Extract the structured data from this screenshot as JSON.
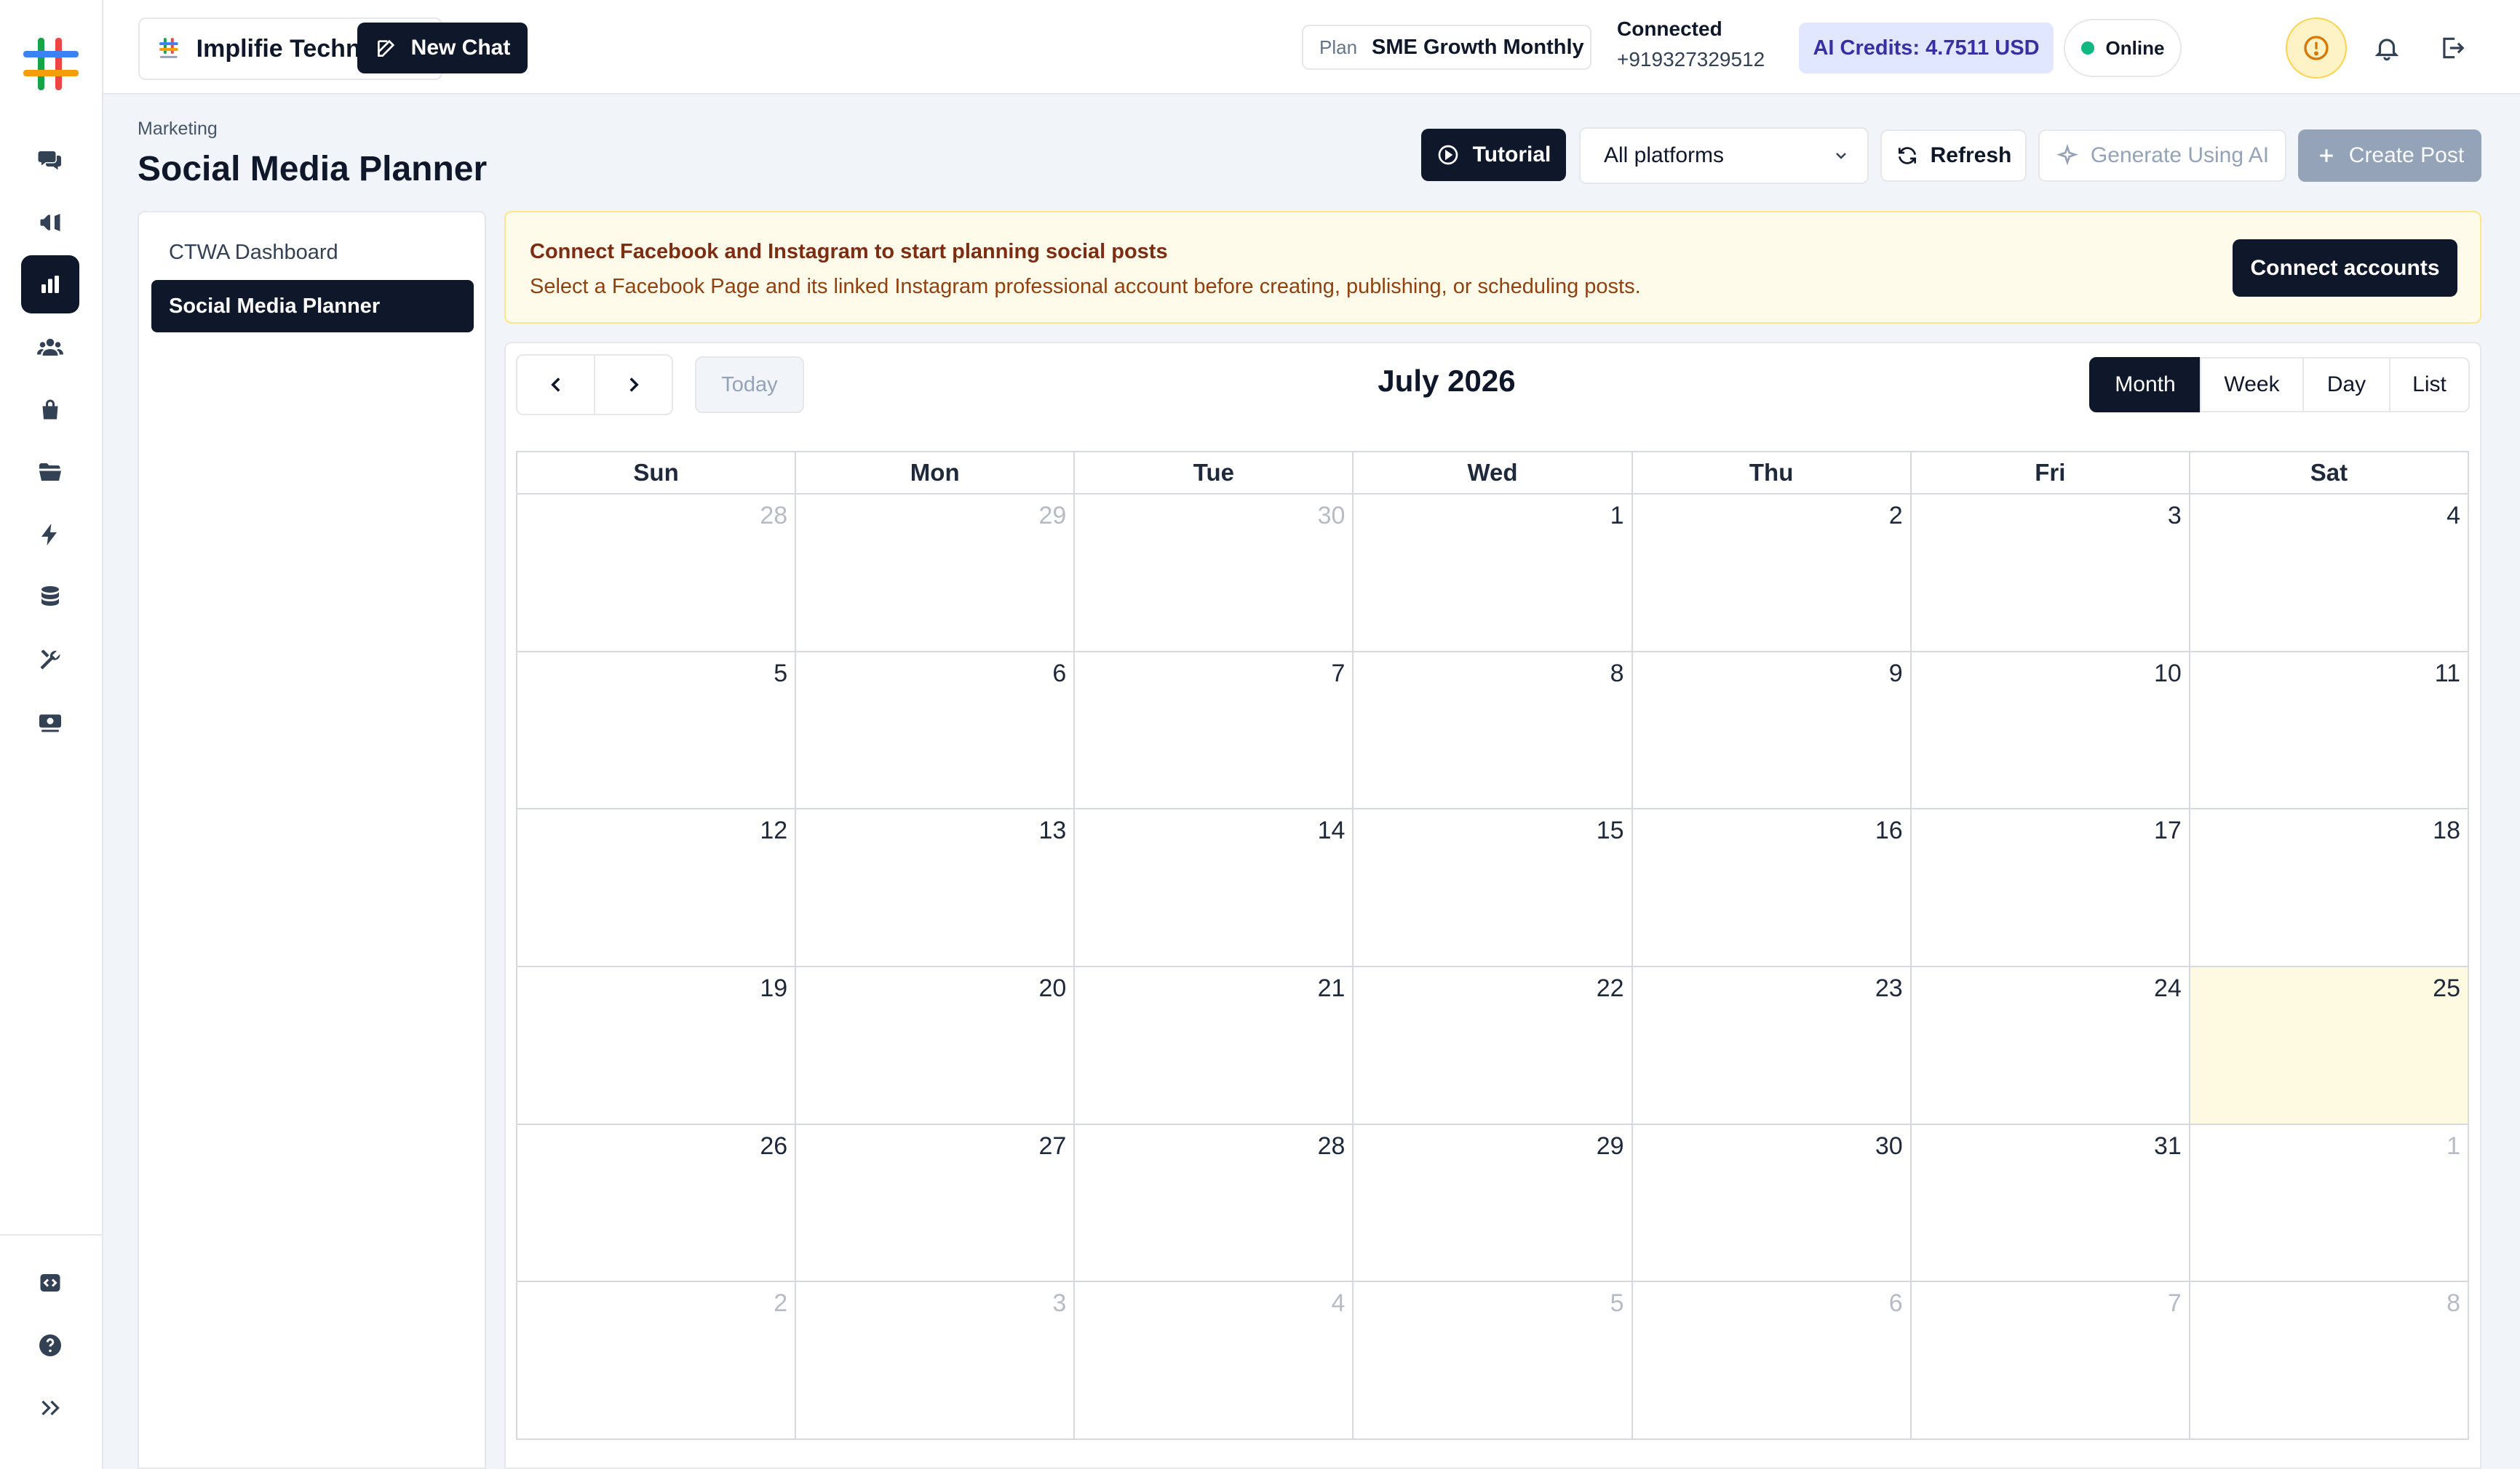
{
  "workspace": {
    "name": "Implifie Technol..."
  },
  "topbar": {
    "new_chat_label": "New Chat",
    "plan_label": "Plan",
    "plan_name": "SME Growth Monthly",
    "connected_title": "Connected",
    "connected_phone": "+919327329512",
    "credits": "AI Credits: 4.7511 USD",
    "status": "Online"
  },
  "page": {
    "breadcrumb": "Marketing",
    "title": "Social Media Planner"
  },
  "toolbar": {
    "tutorial": "Tutorial",
    "platform_filter": "All platforms",
    "refresh": "Refresh",
    "generate": "Generate Using AI",
    "create_post": "Create Post"
  },
  "subnav": {
    "items": [
      {
        "label": "CTWA Dashboard",
        "active": false
      },
      {
        "label": "Social Media Planner",
        "active": true
      }
    ]
  },
  "banner": {
    "title": "Connect Facebook and Instagram to start planning social posts",
    "text": "Select a Facebook Page and its linked Instagram professional account before creating, publishing, or scheduling posts.",
    "button": "Connect accounts"
  },
  "calendar": {
    "title": "July 2026",
    "today_label": "Today",
    "views": [
      "Month",
      "Week",
      "Day",
      "List"
    ],
    "active_view": "Month",
    "weekdays": [
      "Sun",
      "Mon",
      "Tue",
      "Wed",
      "Thu",
      "Fri",
      "Sat"
    ],
    "weeks": [
      [
        "28",
        "29",
        "30",
        "1",
        "2",
        "3",
        "4"
      ],
      [
        "5",
        "6",
        "7",
        "8",
        "9",
        "10",
        "11"
      ],
      [
        "12",
        "13",
        "14",
        "15",
        "16",
        "17",
        "18"
      ],
      [
        "19",
        "20",
        "21",
        "22",
        "23",
        "24",
        "25"
      ],
      [
        "26",
        "27",
        "28",
        "29",
        "30",
        "31",
        "1"
      ],
      [
        "2",
        "3",
        "4",
        "5",
        "6",
        "7",
        "8"
      ]
    ],
    "today_date": "25"
  },
  "colors": {
    "brand_dark": "#0f172a",
    "credits_bg": "#e0e7ff",
    "online_dot": "#10b981",
    "banner_bg": "#fffbeb",
    "today_cell": "#fef9e1"
  }
}
